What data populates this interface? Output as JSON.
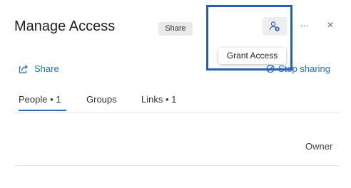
{
  "header": {
    "title": "Manage Access",
    "share_tooltip": "Share",
    "more_label": "···",
    "close_label": "×",
    "grant_access_tooltip": "Grant Access"
  },
  "actions": {
    "share_label": "Share",
    "stop_sharing_label": "Stop sharing"
  },
  "tabs": [
    {
      "label": "People • 1",
      "selected": true
    },
    {
      "label": "Groups",
      "selected": false
    },
    {
      "label": "Links • 1",
      "selected": false
    }
  ],
  "people": [
    {
      "role": "Owner"
    }
  ],
  "colors": {
    "accent": "#1f6fc5",
    "highlight": "#1f5fc7"
  },
  "icons": {
    "grant_access": "add-person-icon",
    "share": "share-icon",
    "stop_sharing": "stop-sharing-icon"
  }
}
